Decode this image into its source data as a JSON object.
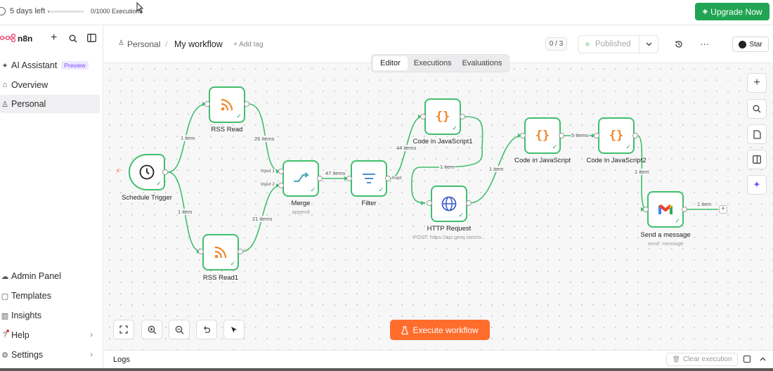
{
  "topbar": {
    "trial_text": "5 days left",
    "executions_text": "0/1000 Executions",
    "upgrade_label": "Upgrade Now",
    "upgrade_icon": "diamond-icon",
    "trial_progress": 0.03
  },
  "sidebar": {
    "brand": "n8n",
    "items": [
      {
        "label": "AI Assistant",
        "icon": "sparkle-icon",
        "badge": "Preview"
      },
      {
        "label": "Overview",
        "icon": "home-icon"
      },
      {
        "label": "Personal",
        "icon": "user-icon"
      }
    ],
    "bottom_items": [
      {
        "label": "Admin Panel",
        "icon": "cloud-icon"
      },
      {
        "label": "Templates",
        "icon": "box-icon"
      },
      {
        "label": "Insights",
        "icon": "chart-icon"
      },
      {
        "label": "Help",
        "icon": "help-icon"
      },
      {
        "label": "Settings",
        "icon": "gear-icon"
      }
    ]
  },
  "header": {
    "breadcrumb_project": "Personal",
    "separator": "/",
    "workflow_name": "My workflow",
    "add_tag": "+ Add tag",
    "counter": "0 / 3",
    "published_label": "Published",
    "more": "···",
    "star_label": "Star",
    "tabs": [
      {
        "label": "Editor",
        "active": true
      },
      {
        "label": "Executions",
        "active": false
      },
      {
        "label": "Evaluations",
        "active": false
      }
    ]
  },
  "nodes": {
    "schedule": {
      "label": "Schedule Trigger",
      "icon": "clock-icon"
    },
    "rss": {
      "label": "RSS Read",
      "icon": "rss-icon"
    },
    "rss1": {
      "label": "RSS Read1",
      "icon": "rss-icon"
    },
    "merge": {
      "label": "Merge",
      "sub": "append",
      "icon": "merge-icon"
    },
    "filter": {
      "label": "Filter",
      "icon": "filter-icon"
    },
    "code1": {
      "label": "Code in JavaScript1",
      "icon": "braces-icon"
    },
    "http": {
      "label": "HTTP Request",
      "sub": "POST: https://api.groq.com/o...",
      "icon": "globe-icon"
    },
    "code": {
      "label": "Code in JavaScript",
      "icon": "braces-icon"
    },
    "code2": {
      "label": "Code in JavaScript2",
      "icon": "braces-icon"
    },
    "gmail": {
      "label": "Send a message",
      "sub": "send: message",
      "icon": "gmail-icon"
    }
  },
  "edges": {
    "e1": "1 item",
    "e2": "1 item",
    "e3": "26 items",
    "e4": "21 items",
    "in1": "Input 1",
    "in2": "Input 2",
    "e5": "47 items",
    "kept": "Kept",
    "e6": "44 items",
    "e7": "1 item",
    "e8": "1 item",
    "e9": "5 items",
    "e10": "1 item",
    "e11": "1 item"
  },
  "canvas": {
    "execute_label": "Execute workflow",
    "execute_icon": "flask-icon"
  },
  "logs": {
    "label": "Logs",
    "clear_label": "Clear execution"
  },
  "colors": {
    "accent": "#ff6d2d",
    "success": "#3fbf6b",
    "upgrade": "#21a453",
    "preview_badge": "#7c4dff"
  }
}
